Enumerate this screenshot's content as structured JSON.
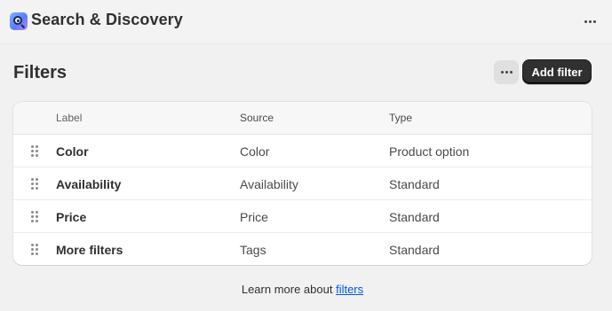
{
  "app": {
    "title": "Search & Discovery",
    "icon": "search-discovery-app-icon"
  },
  "page": {
    "title": "Filters",
    "more_icon": "ellipsis-icon",
    "add_filter_label": "Add filter"
  },
  "table": {
    "headers": {
      "label": "Label",
      "source": "Source",
      "type": "Type"
    },
    "rows": [
      {
        "label": "Color",
        "source": "Color",
        "type": "Product option"
      },
      {
        "label": "Availability",
        "source": "Availability",
        "type": "Standard"
      },
      {
        "label": "Price",
        "source": "Price",
        "type": "Standard"
      },
      {
        "label": "More filters",
        "source": "Tags",
        "type": "Standard"
      }
    ]
  },
  "footer": {
    "text": "Learn more about ",
    "link": "filters"
  },
  "colors": {
    "primary_button": "#303030",
    "link": "#005bd3",
    "background": "#f1f1f1"
  }
}
